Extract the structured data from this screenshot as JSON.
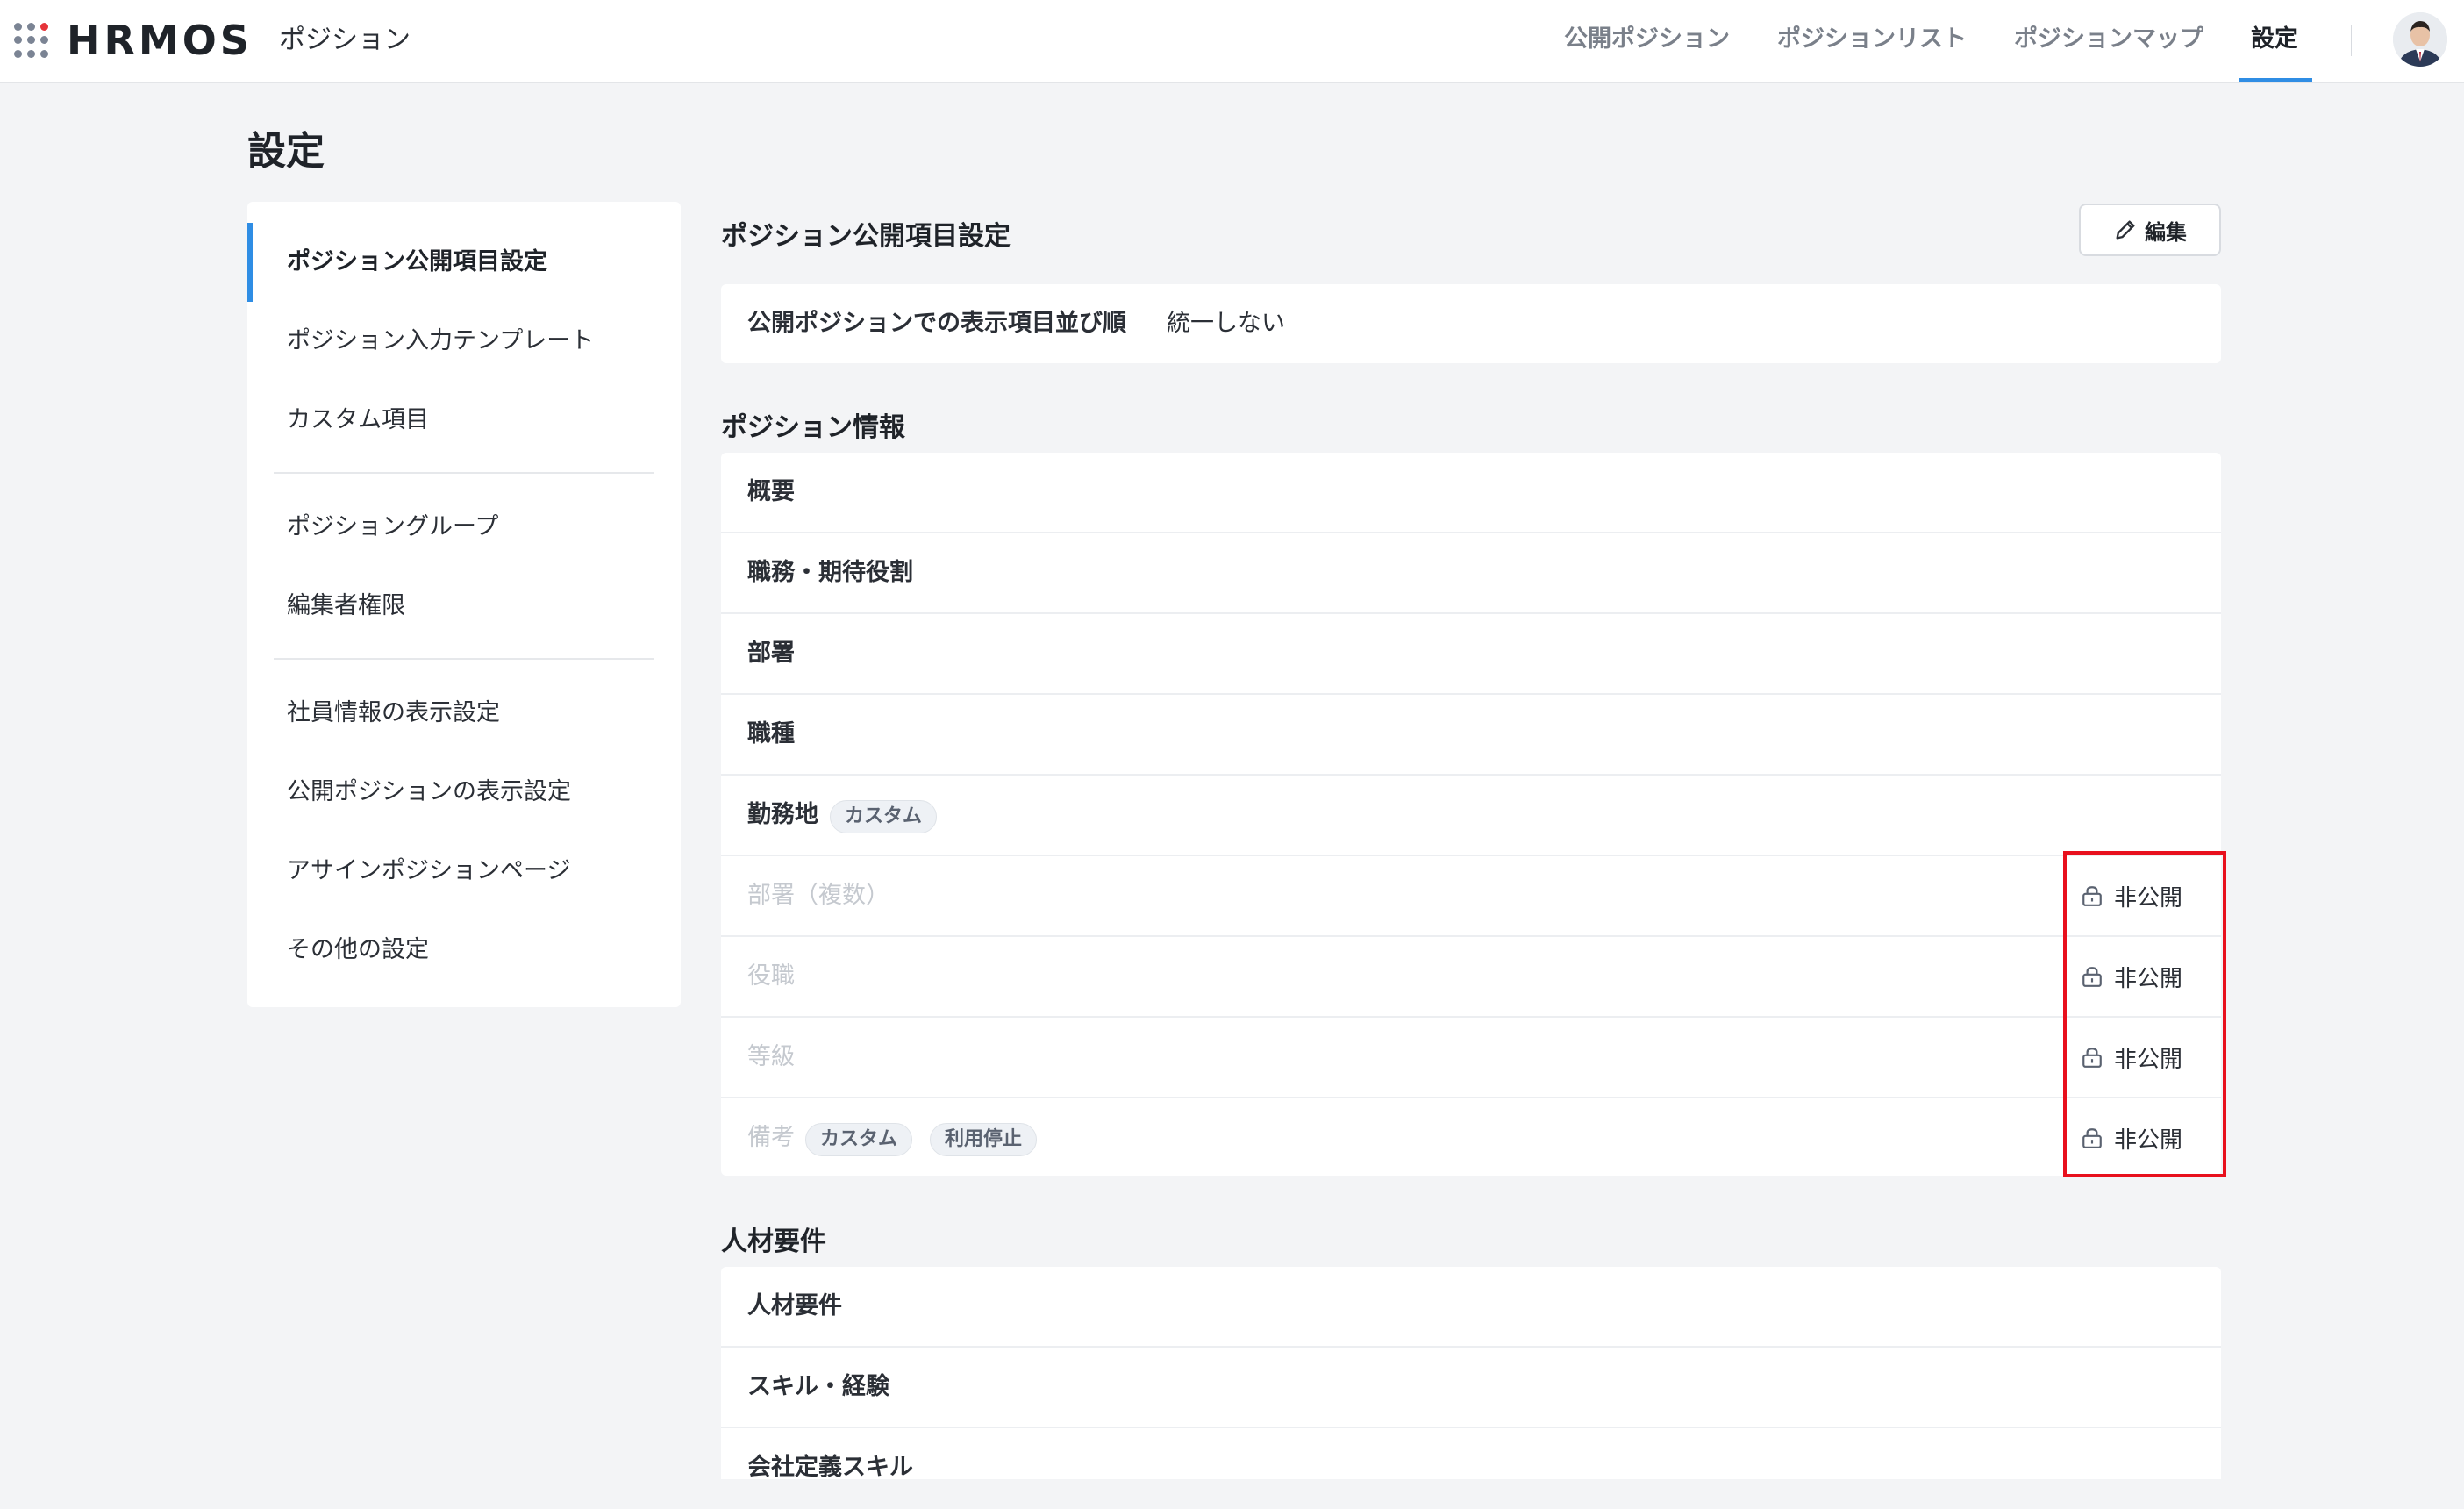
{
  "app": {
    "logo": "HRMOS",
    "product": "ポジション"
  },
  "nav": {
    "tabs": [
      {
        "label": "公開ポジション"
      },
      {
        "label": "ポジションリスト"
      },
      {
        "label": "ポジションマップ"
      },
      {
        "label": "設定",
        "active": true
      }
    ]
  },
  "page": {
    "title": "設定"
  },
  "sidebar": {
    "groups": [
      [
        {
          "label": "ポジション公開項目設定",
          "active": true
        },
        {
          "label": "ポジション入力テンプレート"
        },
        {
          "label": "カスタム項目"
        }
      ],
      [
        {
          "label": "ポジショングループ"
        },
        {
          "label": "編集者権限"
        }
      ],
      [
        {
          "label": "社員情報の表示設定"
        },
        {
          "label": "公開ポジションの表示設定"
        },
        {
          "label": "アサインポジションページ"
        },
        {
          "label": "その他の設定"
        }
      ]
    ]
  },
  "main": {
    "section_title": "ポジション公開項目設定",
    "edit_label": "編集",
    "order": {
      "label": "公開ポジションでの表示項目並び順",
      "value": "統一しない"
    },
    "position_info": {
      "title": "ポジション情報",
      "rows": [
        {
          "label": "概要"
        },
        {
          "label": "職務・期待役割"
        },
        {
          "label": "部署"
        },
        {
          "label": "職種"
        },
        {
          "label": "勤務地",
          "badges": [
            "カスタム"
          ]
        },
        {
          "label": "部署（複数）",
          "disabled": true,
          "status": "非公開"
        },
        {
          "label": "役職",
          "disabled": true,
          "status": "非公開"
        },
        {
          "label": "等級",
          "disabled": true,
          "status": "非公開"
        },
        {
          "label": "備考",
          "disabled": true,
          "badges": [
            "カスタム",
            "利用停止"
          ],
          "status": "非公開"
        }
      ]
    },
    "requirements": {
      "title": "人材要件",
      "rows": [
        {
          "label": "人材要件"
        },
        {
          "label": "スキル・経験"
        },
        {
          "label": "会社定義スキル"
        }
      ]
    }
  },
  "colors": {
    "accent": "#2f8de4",
    "highlight": "#e8101d",
    "background": "#f3f4f6"
  }
}
